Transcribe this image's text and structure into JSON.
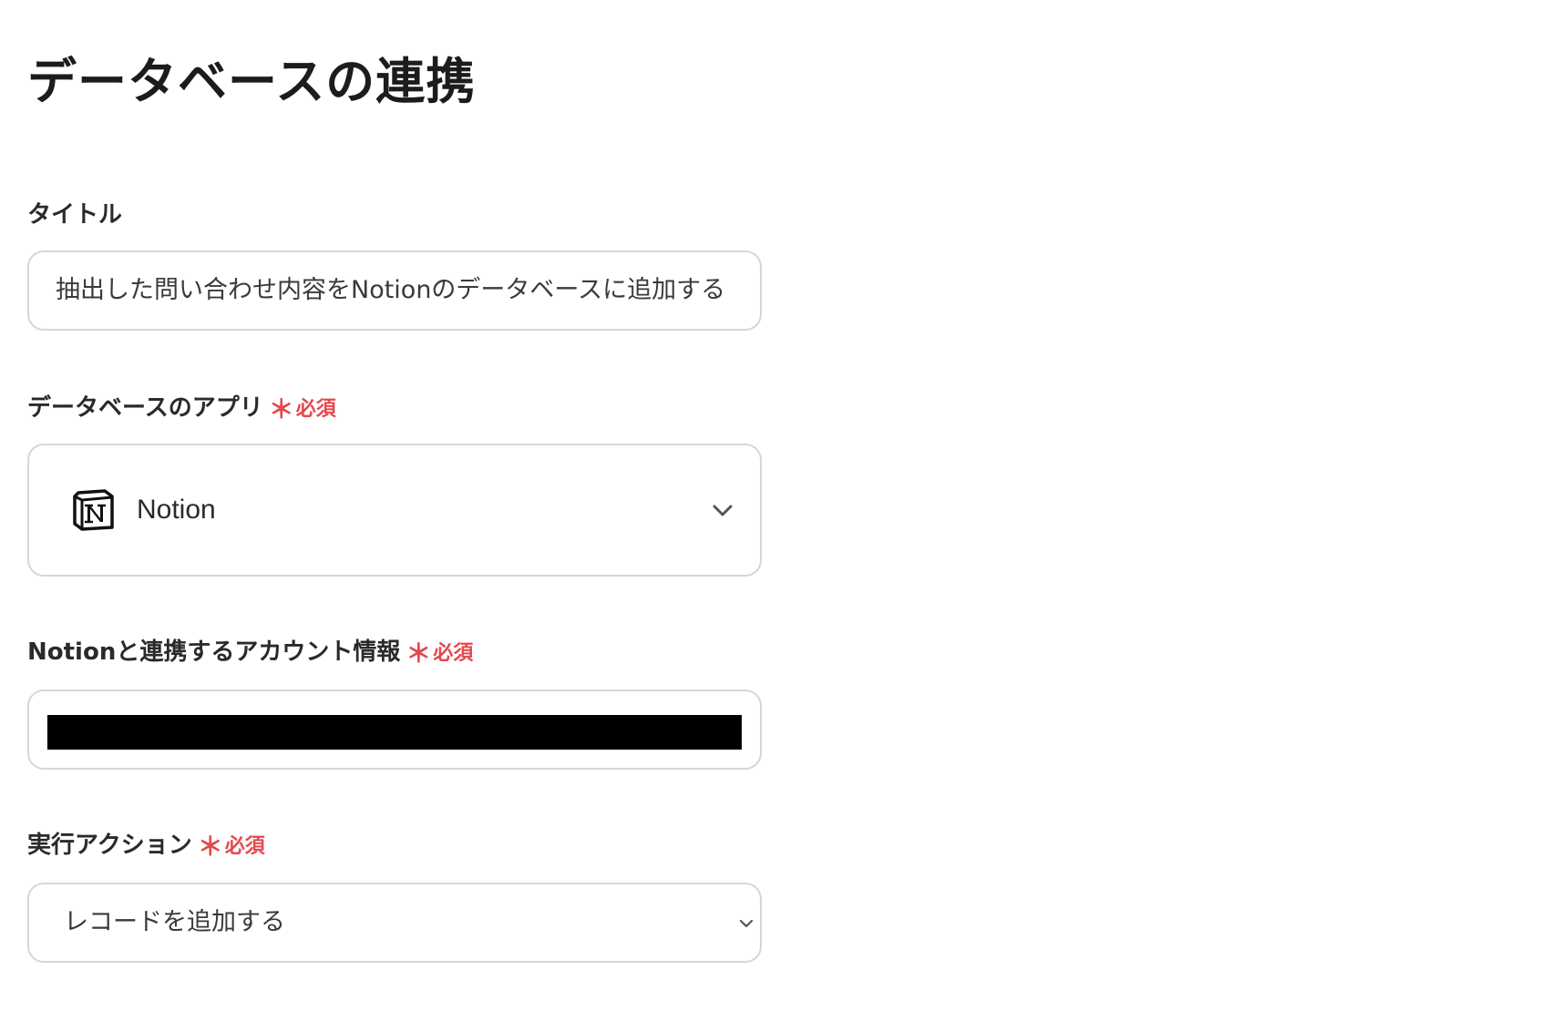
{
  "page": {
    "title": "データベースの連携"
  },
  "required_mark": {
    "star": "＊",
    "label": "必須",
    "color": "#e5484d"
  },
  "fields": {
    "title": {
      "label": "タイトル",
      "value": "抽出した問い合わせ内容をNotionのデータベースに追加する"
    },
    "database_app": {
      "label": "データベースのアプリ",
      "selected": "Notion",
      "icon": "notion-logo-icon"
    },
    "account": {
      "label": "Notionと連携するアカウント情報",
      "redacted": true
    },
    "action": {
      "label": "実行アクション",
      "selected": "レコードを追加する"
    }
  }
}
